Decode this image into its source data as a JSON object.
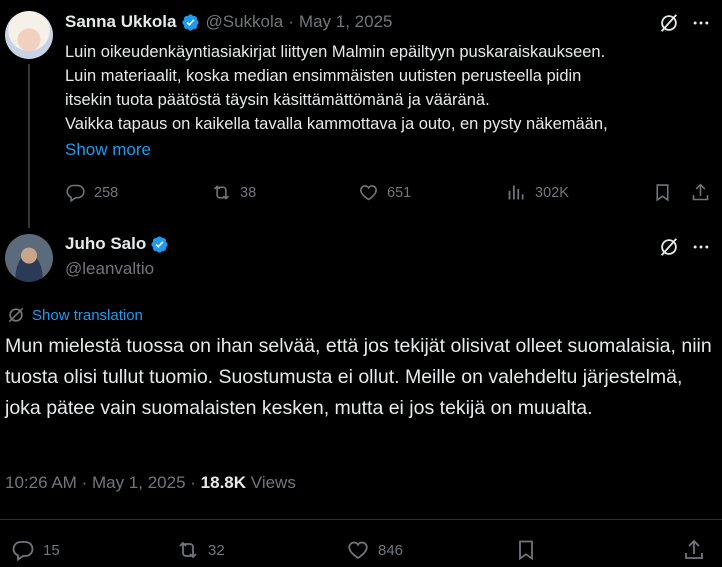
{
  "post1": {
    "name": "Sanna Ukkola",
    "handle": "@Sukkola",
    "separator": "·",
    "date": "May 1, 2025",
    "lines": [
      "Luin oikeudenkäyntiasiakirjat liittyen Malmin epäiltyyn puskaraiskaukseen.",
      "Luin materiaalit, koska median ensimmäisten uutisten perusteella pidin",
      "itsekin tuota päätöstä täysin käsittämättömänä ja vääränä.",
      "Vaikka tapaus on kaikella tavalla kammottava ja outo, en pysty näkemään,"
    ],
    "show_more": "Show more",
    "replies": "258",
    "reposts": "38",
    "likes": "651",
    "views": "302K"
  },
  "post2": {
    "name": "Juho Salo",
    "handle": "@leanvaltio",
    "show_translation": "Show translation",
    "text": "Mun mielestä tuossa on ihan selvää, että jos tekijät olisivat olleet suomalaisia, niin tuosta olisi tullut tuomio. Suostumusta ei ollut. Meille on valehdeltu järjestelmä, joka pätee vain suomalaisten kesken, mutta ei jos tekijä on muualta.",
    "time": "10:26 AM",
    "separator": "·",
    "date": "May 1, 2025",
    "views_count": "18.8K",
    "views_label": "Views",
    "replies": "15",
    "reposts": "32",
    "likes": "846"
  },
  "colors": {
    "background": "#000000",
    "text": "#e7e9ea",
    "muted": "#71767b",
    "accent": "#1d9bf0",
    "divider": "#2f3336"
  },
  "icons": [
    "verified-badge-icon",
    "grok-icon",
    "more-icon",
    "reply-icon",
    "repost-icon",
    "like-icon",
    "views-icon",
    "bookmark-icon",
    "share-icon",
    "translate-icon"
  ]
}
